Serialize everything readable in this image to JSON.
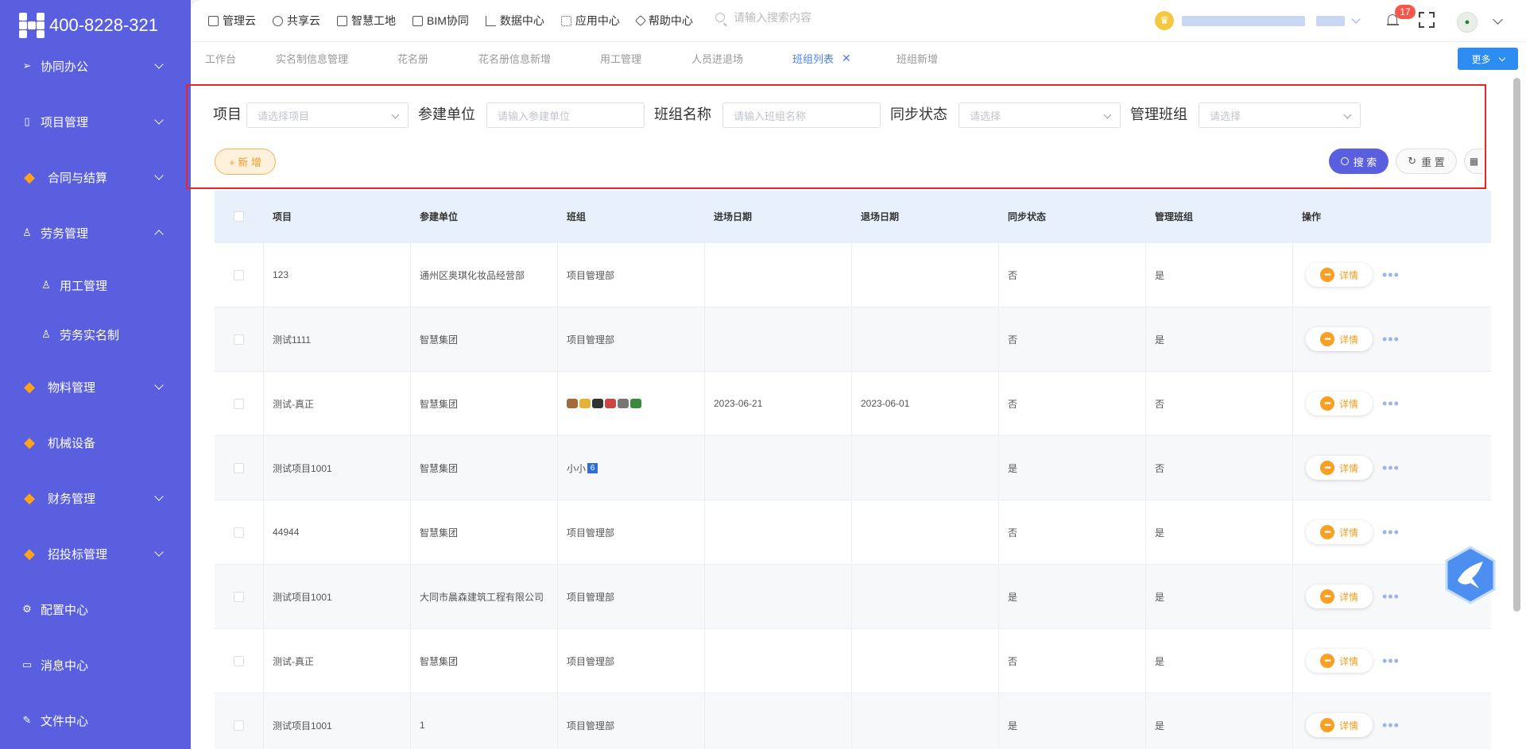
{
  "app": {
    "phone": "400-8228-321"
  },
  "sidebar": {
    "items": [
      {
        "label": "协同办公",
        "icon": "send-icon",
        "expandable": true,
        "expanded": false
      },
      {
        "label": "项目管理",
        "icon": "book-icon",
        "expandable": true,
        "expanded": false
      },
      {
        "label": "合同与结算",
        "icon": "gem-icon",
        "expandable": true,
        "expanded": false
      },
      {
        "label": "劳务管理",
        "icon": "user-icon",
        "expandable": true,
        "expanded": true
      },
      {
        "label": "用工管理",
        "icon": "user-icon",
        "sub": true
      },
      {
        "label": "劳务实名制",
        "icon": "user-icon",
        "sub": true
      },
      {
        "label": "物料管理",
        "icon": "gem-icon",
        "expandable": true,
        "expanded": false
      },
      {
        "label": "机械设备",
        "icon": "gem-icon",
        "expandable": false
      },
      {
        "label": "财务管理",
        "icon": "gem-icon",
        "expandable": true,
        "expanded": false
      },
      {
        "label": "招投标管理",
        "icon": "gem-icon",
        "expandable": true,
        "expanded": false
      },
      {
        "label": "配置中心",
        "icon": "gear-icon",
        "expandable": false
      },
      {
        "label": "消息中心",
        "icon": "message-icon",
        "expandable": false
      },
      {
        "label": "文件中心",
        "icon": "file-icon",
        "expandable": false
      }
    ]
  },
  "topnav": {
    "items": [
      "管理云",
      "共享云",
      "智慧工地",
      "BIM协同",
      "数据中心",
      "应用中心",
      "帮助中心"
    ],
    "search_placeholder": "请输入搜索内容",
    "notification_count": "17"
  },
  "tabs": {
    "items": [
      "工作台",
      "实名制信息管理",
      "花名册",
      "花名册信息新增",
      "用工管理",
      "人员进退场",
      "班组列表",
      "班组新增"
    ],
    "active": 6,
    "more_label": "更多"
  },
  "filter": {
    "project_label": "项目",
    "project_placeholder": "请选择项目",
    "unit_label": "参建单位",
    "unit_placeholder": "请输入参建单位",
    "team_label": "班组名称",
    "team_placeholder": "请输入班组名称",
    "sync_label": "同步状态",
    "sync_placeholder": "请选择",
    "manage_label": "管理班组",
    "manage_placeholder": "请选择",
    "add_label": "+ 新 增",
    "search_label": "搜 索",
    "reset_label": "重 置",
    "columns_label": "▦"
  },
  "table": {
    "columns": [
      "项目",
      "参建单位",
      "班组",
      "进场日期",
      "退场日期",
      "同步状态",
      "管理班组",
      "操作"
    ],
    "detail_label": "详情",
    "rows": [
      {
        "project": "123",
        "unit": "通州区奥琪化妆品经营部",
        "team": "项目管理部",
        "in_date": "",
        "out_date": "",
        "sync": "否",
        "manage": "是"
      },
      {
        "project": "测试1111",
        "unit": "智慧集团",
        "team": "项目管理部",
        "in_date": "",
        "out_date": "",
        "sync": "否",
        "manage": "是"
      },
      {
        "project": "测试-真正",
        "unit": "智慧集团",
        "team": "",
        "in_date": "2023-06-21",
        "out_date": "2023-06-01",
        "sync": "否",
        "manage": "否"
      },
      {
        "project": "测试项目1001",
        "unit": "智慧集团",
        "team": "小小",
        "in_date": "",
        "out_date": "",
        "sync": "是",
        "manage": "否"
      },
      {
        "project": "44944",
        "unit": "智慧集团",
        "team": "项目管理部",
        "in_date": "",
        "out_date": "",
        "sync": "否",
        "manage": "是"
      },
      {
        "project": "测试项目1001",
        "unit": "大同市晨森建筑工程有限公司",
        "team": "项目管理部",
        "in_date": "",
        "out_date": "",
        "sync": "是",
        "manage": "是"
      },
      {
        "project": "测试-真正",
        "unit": "智慧集团",
        "team": "项目管理部",
        "in_date": "",
        "out_date": "",
        "sync": "否",
        "manage": "是"
      },
      {
        "project": "测试项目1001",
        "unit": "1",
        "team": "项目管理部",
        "in_date": "",
        "out_date": "",
        "sync": "是",
        "manage": "是"
      }
    ]
  },
  "colors": {
    "sidebar": "#5a5fe0",
    "accent": "#4a7ff5",
    "primary_button": "#5a5fe0",
    "warning": "#f39b1b",
    "badge": "#f5574b"
  }
}
